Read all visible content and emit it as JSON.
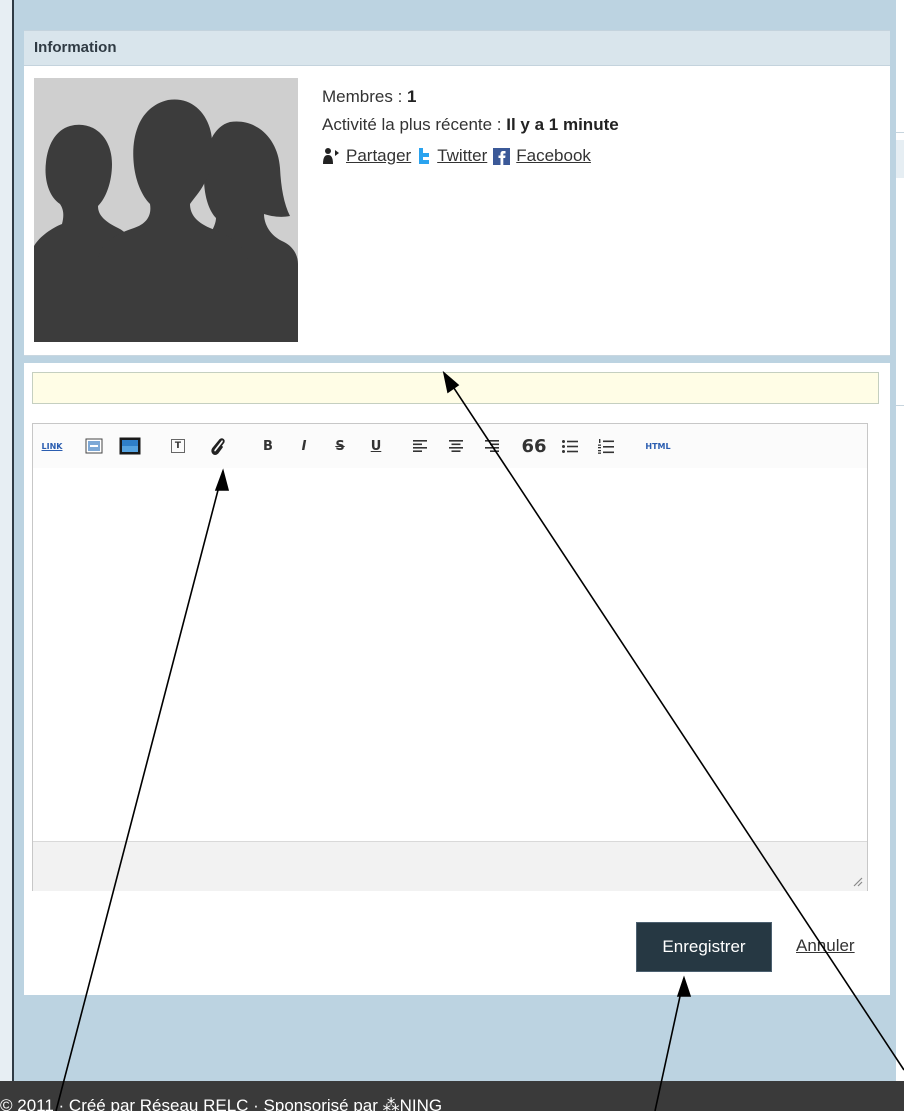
{
  "info_card": {
    "title": "Information",
    "members_label": "Membres : ",
    "members_value": "1",
    "activity_label": "Activité la plus récente : ",
    "activity_value": "Il y a 1 minute",
    "share": {
      "partager": "Partager",
      "twitter": "Twitter",
      "facebook": "Facebook"
    }
  },
  "editor": {
    "title_value": "",
    "toolbar": {
      "link": "LINK",
      "bold": "B",
      "italic": "I",
      "strike": "S",
      "underline": "U",
      "quote": "66",
      "text_box": "T",
      "html": "HTML"
    }
  },
  "actions": {
    "save_label": "Enregistrer",
    "cancel_label": "Annuler"
  },
  "footer": {
    "text": "© 2011 · Créé par Réseau RELC · Sponsorisé par ⁂NING"
  },
  "colors": {
    "page_background": "#bcd3e1",
    "card_header": "#d9e5ec",
    "title_input_bg": "#fffde6",
    "save_button": "#263843",
    "footer_bg": "#3a3a3a",
    "avatar_silhouette": "#3c3c3c"
  }
}
